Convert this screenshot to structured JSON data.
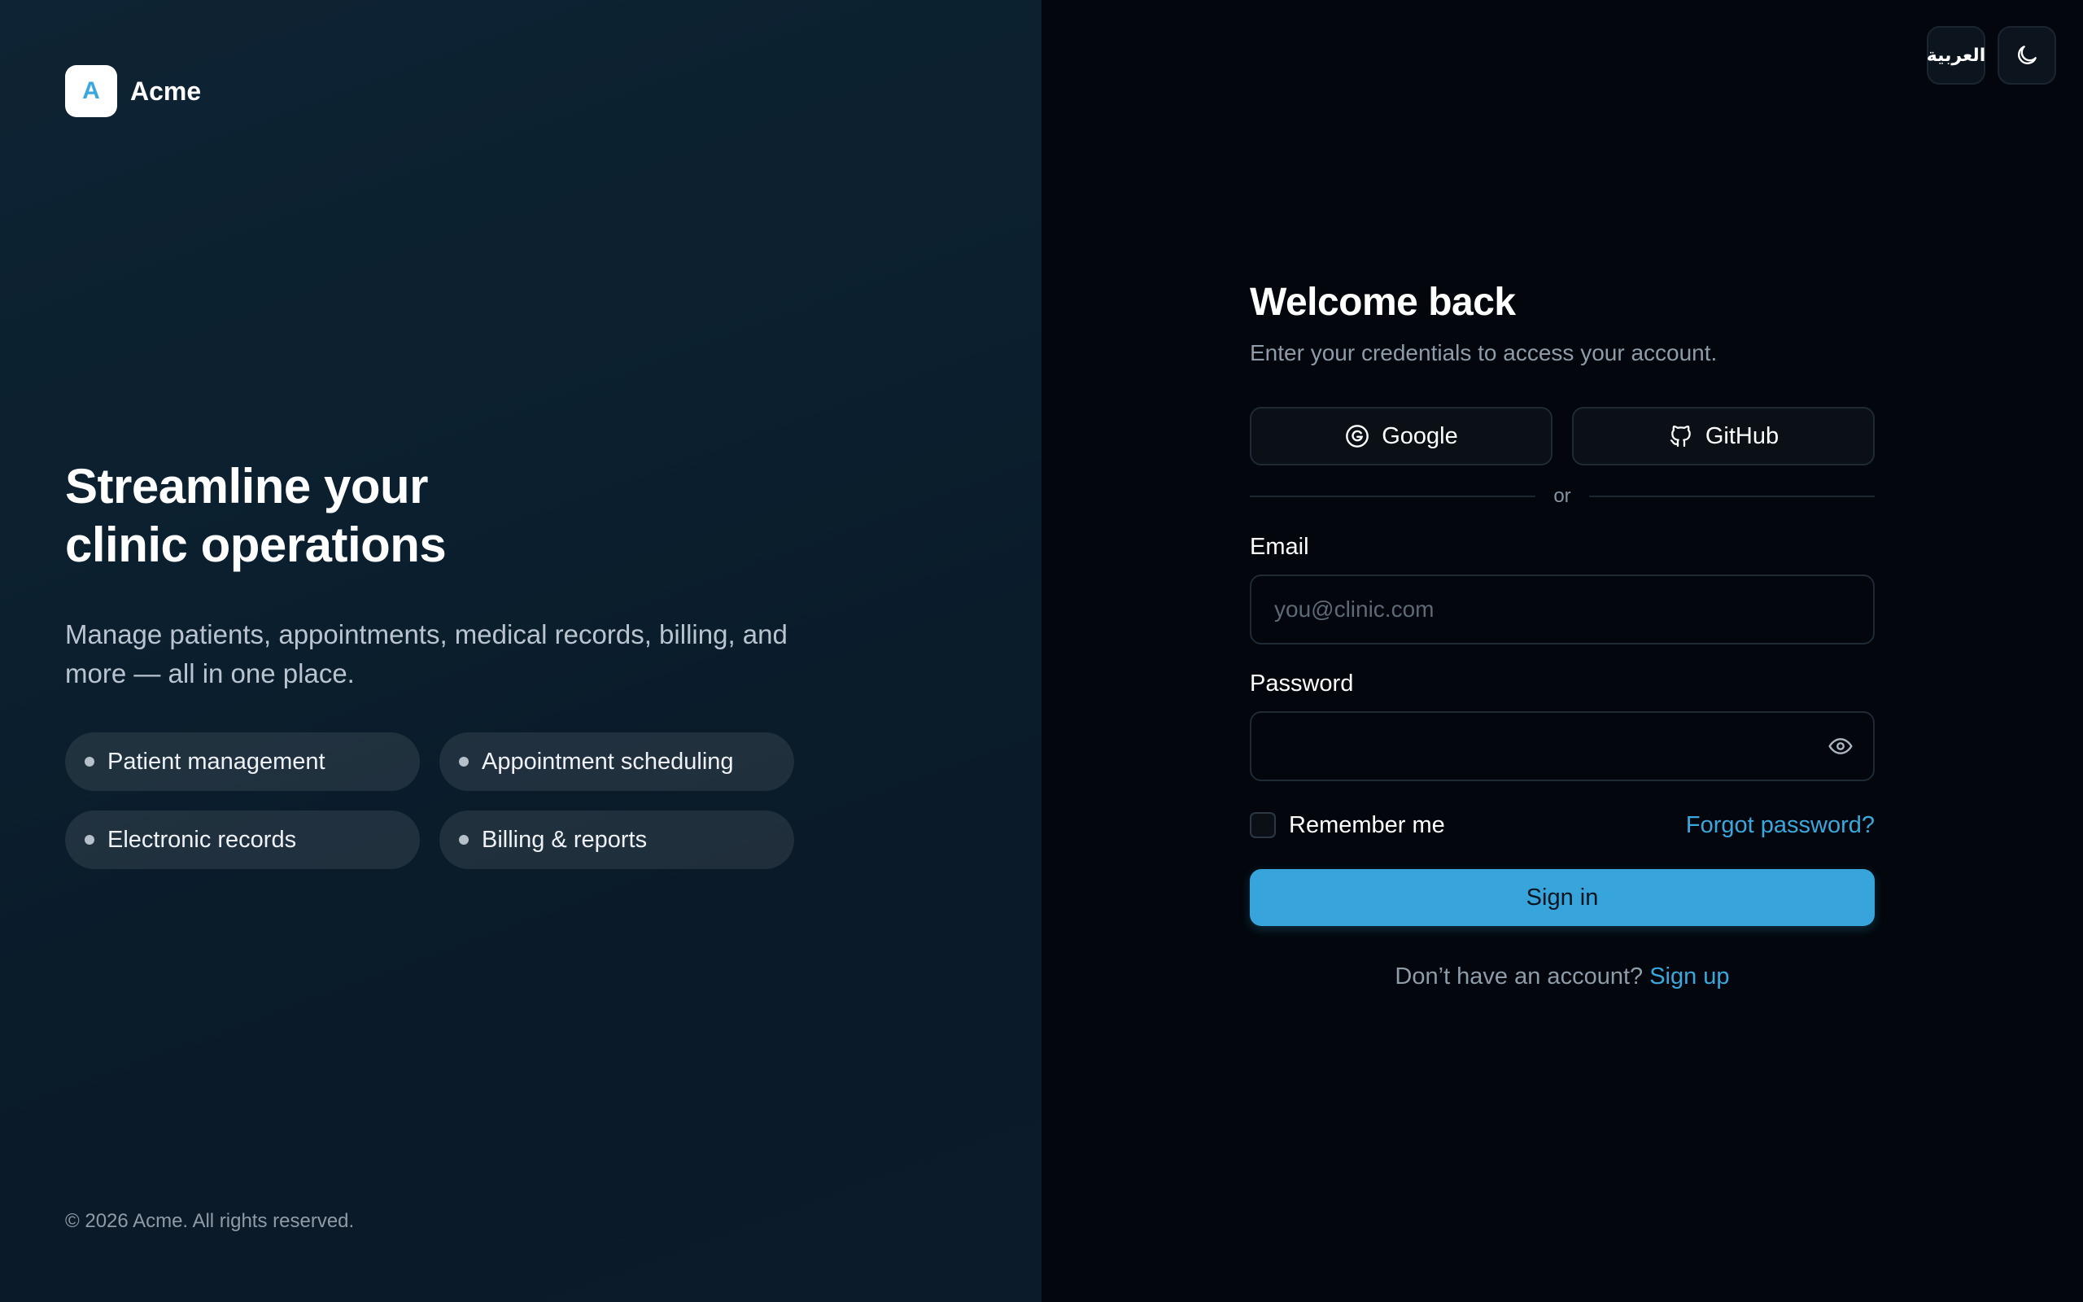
{
  "brand": {
    "logo_letter": "A",
    "name": "Acme"
  },
  "hero": {
    "title_line1": "Streamline your",
    "title_line2": "clinic operations",
    "description": "Manage patients, appointments, medical records, billing, and more — all in one place.",
    "features": [
      "Patient management",
      "Appointment scheduling",
      "Electronic records",
      "Billing & reports"
    ]
  },
  "footer": {
    "copyright": "© 2026 Acme. All rights reserved."
  },
  "topbar": {
    "language_label": "العربية",
    "theme_icon": "moon-icon"
  },
  "login": {
    "title": "Welcome back",
    "subtitle": "Enter your credentials to access your account.",
    "google_label": "Google",
    "github_label": "GitHub",
    "divider_text": "or",
    "email_label": "Email",
    "email_placeholder": "you@clinic.com",
    "email_value": "",
    "password_label": "Password",
    "password_value": "",
    "remember_label": "Remember me",
    "remember_checked": false,
    "forgot_label": "Forgot password?",
    "signin_label": "Sign in",
    "signup_prompt": "Don’t have an account?",
    "signup_link": "Sign up"
  },
  "colors": {
    "accent": "#37a5db",
    "link": "#3aa7dd",
    "left_panel": "#0b1f2e",
    "right_panel": "#03070d"
  }
}
